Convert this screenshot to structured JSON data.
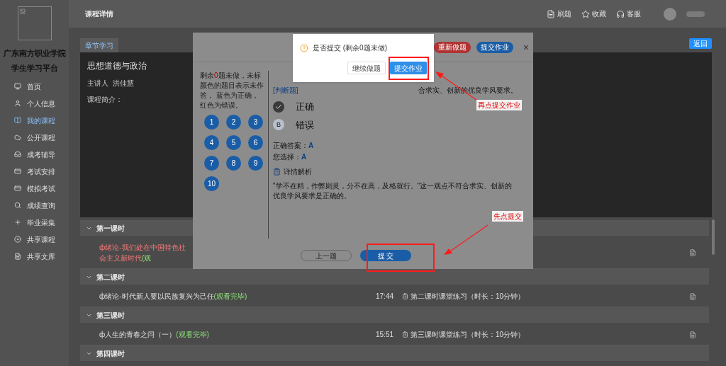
{
  "sidebar": {
    "school": "广东南方职业学院",
    "platform": "学生学习平台",
    "items": [
      {
        "label": "首页",
        "selected": false
      },
      {
        "label": "个人信息",
        "selected": false
      },
      {
        "label": "我的课程",
        "selected": true
      },
      {
        "label": "公开课程",
        "selected": false
      },
      {
        "label": "成考辅导",
        "selected": false
      },
      {
        "label": "考试安排",
        "selected": false
      },
      {
        "label": "模拟考试",
        "selected": false
      },
      {
        "label": "成绩查询",
        "selected": false
      },
      {
        "label": "毕业采集",
        "selected": false
      },
      {
        "label": "共享课程",
        "selected": false
      },
      {
        "label": "共享文库",
        "selected": false
      }
    ]
  },
  "header": {
    "title": "课程详情",
    "actions": [
      "刷题",
      "收藏",
      "客服"
    ]
  },
  "tabs": [
    {
      "label": "章节学习",
      "selected": true
    }
  ],
  "back_button": "返回",
  "course": {
    "title": "思想道德与政治",
    "lecturer_label": "主讲人",
    "lecturer": "洪佳慧",
    "intro_label": "课程简介："
  },
  "sections": [
    {
      "title": "第一课时",
      "expanded": true,
      "rows": [
        {
          "title": "ф绪论-我们处在中国特色社会主义新时代",
          "status": "(观",
          "watched": false
        }
      ]
    },
    {
      "title": "第二课时",
      "expanded": true,
      "rows": [
        {
          "title": "ф绪论-时代新人要以民族复兴为己任",
          "status": "(观看完毕)",
          "watched": true,
          "time": "17:44",
          "exercise": "第二课时课堂练习（时长：10分钟）"
        }
      ]
    },
    {
      "title": "第三课时",
      "expanded": true,
      "rows": [
        {
          "title": "ф人生的青春之问（一）",
          "status": "(观看完毕)",
          "watched": true,
          "time": "15:51",
          "exercise": "第三课时课堂练习（时长：10分钟）"
        }
      ]
    },
    {
      "title": "第四课时",
      "expanded": true
    }
  ],
  "quiz": {
    "buttons": [
      {
        "label": "重新做题",
        "kind": "danger"
      },
      {
        "label": "提交作业",
        "kind": "primary"
      }
    ],
    "close": "×",
    "note": {
      "before": "剩余",
      "count": "0",
      "after": "题未做，未标颜色的题目表示未作答， 蓝色为正确，红色为错误。"
    },
    "numbers": [
      {
        "label": "1",
        "correct": true
      },
      {
        "label": "2",
        "correct": true
      },
      {
        "label": "3",
        "correct": true
      },
      {
        "label": "4",
        "correct": true
      },
      {
        "label": "5",
        "correct": true
      },
      {
        "label": "6",
        "correct": true
      },
      {
        "label": "7",
        "correct": true
      },
      {
        "label": "8",
        "correct": true
      },
      {
        "label": "9",
        "correct": true
      },
      {
        "label": "10",
        "correct": true
      }
    ],
    "question_type": "[判断题]",
    "question_tail": "合求实、创新的优良学风要求。",
    "options": [
      {
        "label": "正确",
        "selected": true
      },
      {
        "letter": "B",
        "label": "错误",
        "selected": false
      }
    ],
    "correct_label": "正确答案：",
    "correct_value": "A",
    "chosen_label": "您选择：",
    "chosen_value": "A",
    "analysis_title": "详情解析",
    "analysis": "\"学不在精，作弊则灵，分不在高，及格就行。\"这一观点不符合求实、创新的优良学风要求是正确的。",
    "prev_button": "上一题",
    "submit_button": "提 交"
  },
  "confirm": {
    "message": "是否提交 (剩余0题未做)",
    "buttons": [
      {
        "label": "继续做题",
        "kind": "default"
      },
      {
        "label": "提交作业",
        "kind": "primary"
      }
    ]
  },
  "annotations": [
    {
      "text": "再点提交作业"
    },
    {
      "text": "先点提交"
    }
  ]
}
